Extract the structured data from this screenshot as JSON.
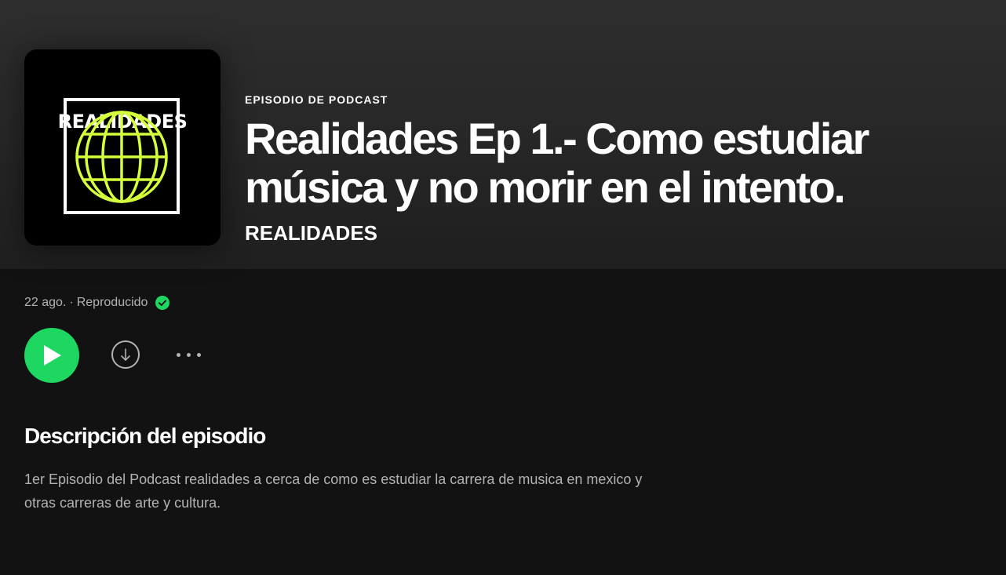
{
  "cover": {
    "title": "REALIDADES",
    "accent_color": "#d4ff3a",
    "icon": "globe-icon"
  },
  "episode": {
    "type_label": "EPISODIO DE PODCAST",
    "title": "Realidades Ep 1.- Como estudiar música y no morir en el intento.",
    "show_name": "REALIDADES"
  },
  "sub_meta": {
    "date": "22 ago.",
    "separator": "·",
    "status": "Reproducido",
    "status_icon": "check-circle-icon",
    "status_color": "#1ed760"
  },
  "controls": {
    "play_icon": "play-icon",
    "download_icon": "download-icon",
    "more_icon": "more-options-icon",
    "play_color": "#1ed760"
  },
  "description": {
    "heading": "Descripción del episodio",
    "body": "1er Episodio del Podcast realidades a cerca de como es estudiar la carrera de musica en mexico y otras carreras de arte y cultura."
  }
}
